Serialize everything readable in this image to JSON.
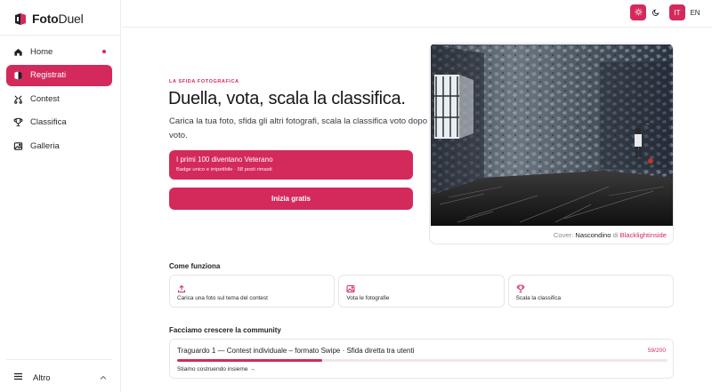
{
  "brand": {
    "name_bold": "Foto",
    "name_light": "Duel"
  },
  "sidebar": {
    "items": [
      {
        "label": "Home",
        "icon": "home-icon",
        "active": false,
        "dot": true
      },
      {
        "label": "Registrati",
        "icon": "register-icon",
        "active": true,
        "dot": false
      },
      {
        "label": "Contest",
        "icon": "contest-icon",
        "active": false,
        "dot": false
      },
      {
        "label": "Classifica",
        "icon": "trophy-icon",
        "active": false,
        "dot": false
      },
      {
        "label": "Galleria",
        "icon": "gallery-icon",
        "active": false,
        "dot": false
      }
    ],
    "more_label": "Altro"
  },
  "topbar": {
    "theme": {
      "light_icon": "sun-icon",
      "dark_icon": "moon-icon",
      "selected": "light"
    },
    "languages": [
      "IT",
      "EN"
    ],
    "selected_language": "IT"
  },
  "hero": {
    "eyebrow": "LA SFIDA FOTOGRAFICA",
    "headline": "Duella, vota, scala la classifica.",
    "subtitle": "Carica la tua foto, sfida gli altri fotografi, scala la classifica voto dopo voto.",
    "promo_title": "I primi 100 diventano Veterano",
    "promo_sub": "Badge unico e irripetibile · 58 posti rimasti",
    "cta": "Inizia gratis"
  },
  "cover": {
    "prefix": "Cover:",
    "title": "Nascondino",
    "by": "di",
    "author": "Blacklightinside"
  },
  "how": {
    "title": "Come funziona",
    "steps": [
      {
        "icon": "upload-icon",
        "label": "Carica una foto sul tema del contest"
      },
      {
        "icon": "image-icon",
        "label": "Vota le fotografie"
      },
      {
        "icon": "trophy-icon",
        "label": "Scala la classifica"
      }
    ]
  },
  "community": {
    "title": "Facciamo crescere la community",
    "milestone": "Traguardo 1 — Contest individuale – formato Swipe · Sfida diretta tra utenti",
    "count_text": "59/200",
    "progress_fraction": 0.295,
    "link": "Stiamo costruendo insieme →"
  },
  "colors": {
    "accent": "#d42a5b",
    "border": "#e6e6ea",
    "text": "#1f1f24"
  }
}
